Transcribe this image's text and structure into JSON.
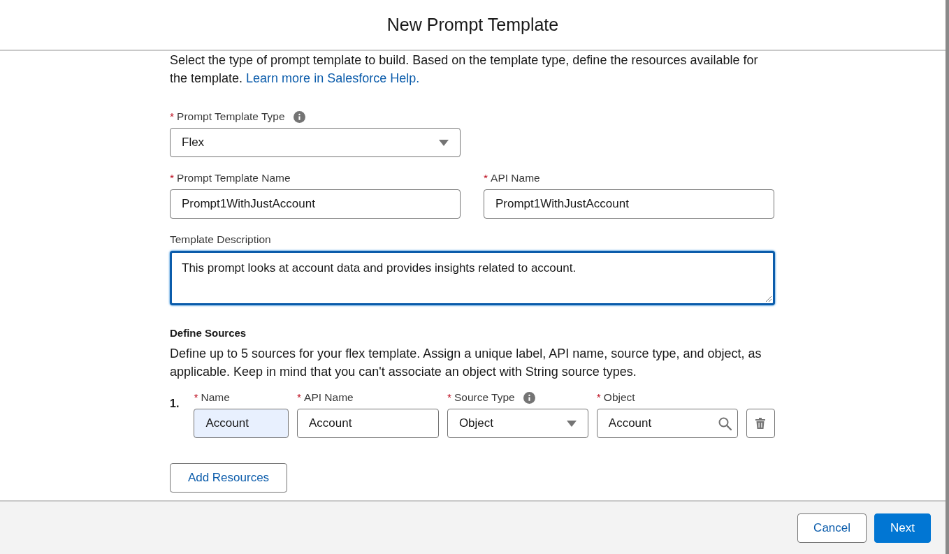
{
  "modal": {
    "title": "New Prompt Template"
  },
  "intro": {
    "text": "Select the type of prompt template to build. Based on the template type, define the resources available for the template.",
    "link": "Learn more in Salesforce Help."
  },
  "fields": [
    {
      "kind": "select",
      "label": "Prompt Template Type",
      "asterisk": "*",
      "info": true,
      "value": "Flex",
      "focused": false
    },
    {
      "kind": "text",
      "label": "Prompt Template Name",
      "asterisk": "*",
      "info": false,
      "value": "Prompt1WithJustAccount",
      "focused": false
    },
    {
      "kind": "text",
      "label": "API Name",
      "asterisk": "*",
      "info": false,
      "value": "Prompt1WithJustAccount",
      "focused": false
    },
    {
      "kind": "textarea",
      "label": "Template Description",
      "info": false,
      "value": "This prompt looks at account data and provides insights related to account.",
      "focused": true
    }
  ],
  "sources": {
    "heading": "Define Sources",
    "description": "Define up to 5 sources for your flex template. Assign a unique label, API name, source type, and object, as applicable. Keep in mind that you can't associate an object with String source types.",
    "rows": [
      {
        "number": "1.",
        "fields": [
          {
            "kind": "text",
            "label": "Name",
            "asterisk": "*",
            "info": false,
            "value": "Account",
            "highlighted": true
          },
          {
            "kind": "text",
            "label": "API Name",
            "asterisk": "*",
            "info": false,
            "value": "Account",
            "highlighted": false
          },
          {
            "kind": "select",
            "label": "Source Type",
            "asterisk": "*",
            "info": true,
            "value": "Object",
            "highlighted": false
          },
          {
            "kind": "lookup",
            "label": "Object",
            "asterisk": "*",
            "info": false,
            "value": "Account",
            "highlighted": false
          }
        ]
      }
    ],
    "add_button": "Add Resources"
  },
  "footer": {
    "buttons": [
      {
        "label": "Cancel",
        "kind": "neutral"
      },
      {
        "label": "Next",
        "kind": "brand"
      }
    ]
  }
}
